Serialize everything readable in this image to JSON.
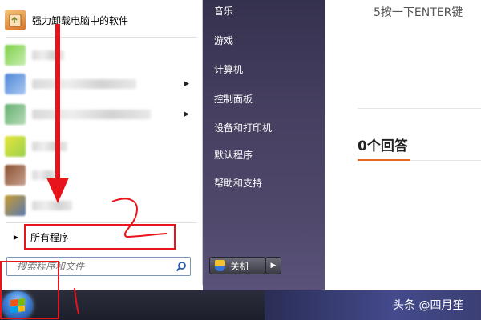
{
  "start_menu": {
    "top_program": "强力卸载电脑中的软件",
    "all_programs": "所有程序",
    "search_placeholder": "搜索程序和文件",
    "right_items": [
      "音乐",
      "游戏",
      "计算机",
      "控制面板",
      "设备和打印机",
      "默认程序",
      "帮助和支持"
    ],
    "shutdown": "关机"
  },
  "webpage": {
    "hint": "5按一下ENTER键",
    "answers": "0个回答"
  },
  "watermark": "头条 @四月笙",
  "colors": {
    "annotation_red": "#e8141c",
    "accent_orange": "#e9681f",
    "menu_purple": "#453e5f"
  },
  "icons": [
    "uninstall-icon",
    "search-icon",
    "shutdown-shield-icon",
    "windows-logo-icon",
    "chevron-right-icon",
    "triangle-right-icon"
  ]
}
